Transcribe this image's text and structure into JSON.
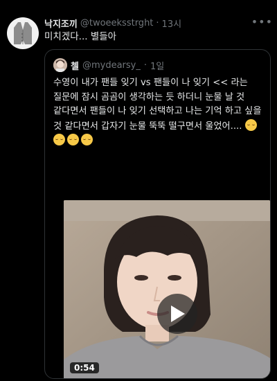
{
  "tweet": {
    "author_name": "낙지조끼",
    "handle": "@twoeeksstrght",
    "separator": "·",
    "time": "13시",
    "text": "미치겠다... 별들아"
  },
  "quote": {
    "author_name": "첼",
    "handle": "@mydearsy_",
    "separator": "·",
    "time": "1일",
    "text": "수영이 내가 팬들 잊기 vs 팬들이 나 잊기 << 라는 질문에 잠시 곰곰이 생각하는 듯 하더니 눈물 날 것 같다면서 팬들이 나 잊기 선택하고 나는 기억 하고 싶을 것 같다면서 갑자기 눈물 뚝뚝 떨구면서 울었어....",
    "video": {
      "duration": "0:54"
    }
  },
  "icons": {
    "avatar": "vest-icon",
    "more": "more-icon",
    "play": "play-icon",
    "emoji": "crying-face-icon"
  }
}
